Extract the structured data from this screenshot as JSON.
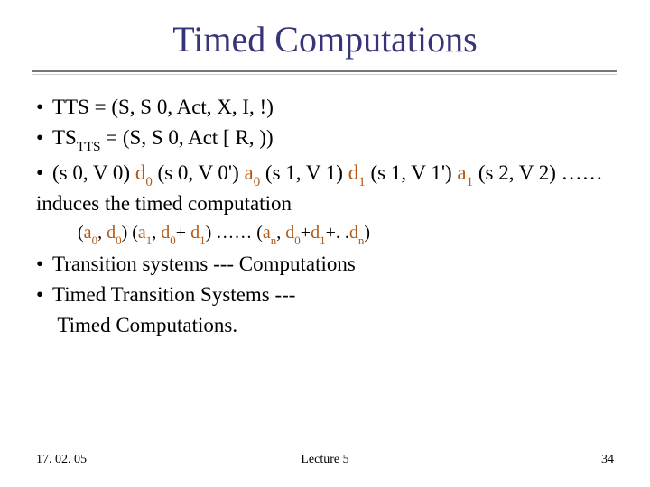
{
  "title": "Timed Computations",
  "bullets": {
    "b1": "TTS = (S, S 0, Act, X, I, !)",
    "b2_a": "TS",
    "b2_sub": "TTS",
    "b2_b": " = (S, S 0, Act [ R, ))",
    "b3_a": "(s 0, V 0) ",
    "b3_d0": "d",
    "b3_d0s": "0",
    "b3_b": " (s 0, V 0') ",
    "b3_a0": "a",
    "b3_a0s": "0",
    "b3_c": " (s 1, V 1) ",
    "b3_d1": "d",
    "b3_d1s": "1",
    "b3_d": " (s 1, V 1') ",
    "b3_a1": "a",
    "b3_a1s": "1",
    "b3_e": " (s 2, V 2) …… induces the timed computation",
    "sub1_a": "(",
    "sub1_a0": "a",
    "sub1_a0s": "0",
    "sub1_b": ", ",
    "sub1_d0": "d",
    "sub1_d0s": "0",
    "sub1_c": ") (",
    "sub1_a1": "a",
    "sub1_a1s": "1",
    "sub1_d": ", ",
    "sub1_d00": "d",
    "sub1_d00s": "0",
    "sub1_e": "+ ",
    "sub1_d1": "d",
    "sub1_d1s": "1",
    "sub1_f": ") …… (",
    "sub1_an": "a",
    "sub1_ans": "n",
    "sub1_g": ", ",
    "sub1_dn0": "d",
    "sub1_dn0s": "0",
    "sub1_h": "+",
    "sub1_dn1": "d",
    "sub1_dn1s": "1",
    "sub1_i": "+. .",
    "sub1_dnn": "d",
    "sub1_dnns": "n",
    "sub1_j": ")",
    "b4": "Transition systems --- Computations",
    "b5": "Timed Transition Systems ---",
    "b5b": " Timed Computations."
  },
  "footer": {
    "date": "17. 02. 05",
    "lecture": "Lecture 5",
    "page": "34"
  }
}
